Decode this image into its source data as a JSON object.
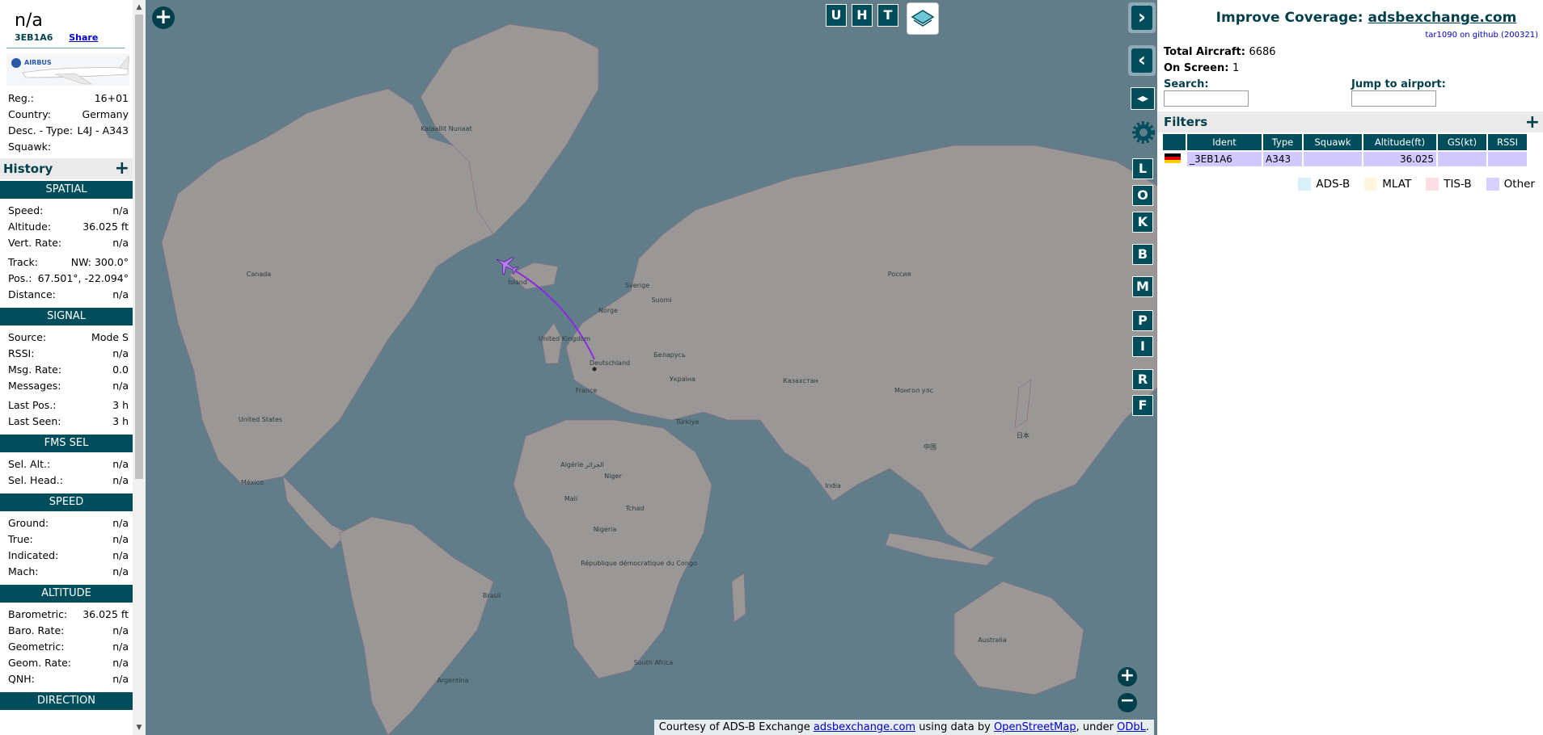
{
  "aircraft": {
    "callsign": "n/a",
    "hex": "3EB1A6",
    "share_label": "Share",
    "photo_alt": "AIRBUS",
    "reg_label": "Reg.:",
    "reg_value": "16+01",
    "country_label": "Country:",
    "country_value": "Germany",
    "desc_label": "Desc. - Type:",
    "desc_value": "L4J - A343",
    "squawk_label": "Squawk:",
    "squawk_value": ""
  },
  "history_label": "History",
  "sections": {
    "spatial": "SPATIAL",
    "signal": "SIGNAL",
    "fms": "FMS SEL",
    "speed": "SPEED",
    "altitude": "ALTITUDE",
    "direction": "DIRECTION"
  },
  "spatial": [
    {
      "label": "Speed:",
      "value": "n/a"
    },
    {
      "label": "Altitude:",
      "value": "36.025 ft"
    },
    {
      "label": "Vert. Rate:",
      "value": "n/a"
    },
    {
      "label": "Track:",
      "value": "NW: 300.0°"
    },
    {
      "label": "Pos.:",
      "value": "67.501°, -22.094°"
    },
    {
      "label": "Distance:",
      "value": "n/a"
    }
  ],
  "signal": [
    {
      "label": "Source:",
      "value": "Mode S"
    },
    {
      "label": "RSSI:",
      "value": "n/a"
    },
    {
      "label": "Msg. Rate:",
      "value": "0.0"
    },
    {
      "label": "Messages:",
      "value": "n/a"
    },
    {
      "label": "Last Pos.:",
      "value": "3 h"
    },
    {
      "label": "Last Seen:",
      "value": "3 h"
    }
  ],
  "fms": [
    {
      "label": "Sel. Alt.:",
      "value": "n/a"
    },
    {
      "label": "Sel. Head.:",
      "value": "n/a"
    }
  ],
  "speed": [
    {
      "label": "Ground:",
      "value": "n/a"
    },
    {
      "label": "True:",
      "value": "n/a"
    },
    {
      "label": "Indicated:",
      "value": "n/a"
    },
    {
      "label": "Mach:",
      "value": "n/a"
    }
  ],
  "altitude": [
    {
      "label": "Barometric:",
      "value": "36.025 ft"
    },
    {
      "label": "Baro. Rate:",
      "value": "n/a"
    },
    {
      "label": "Geometric:",
      "value": "n/a"
    },
    {
      "label": "Geom. Rate:",
      "value": "n/a"
    },
    {
      "label": "QNH:",
      "value": "n/a"
    }
  ],
  "map": {
    "top_buttons": [
      "U",
      "H",
      "T"
    ],
    "side_buttons": [
      "L",
      "O",
      "K",
      "B",
      "M",
      "P",
      "I",
      "R",
      "F"
    ],
    "labels": {
      "greenland": "Kalaallit Nunaat",
      "canada": "Canada",
      "us": "United States",
      "mexico": "México",
      "island": "Ísland",
      "sverige": "Sverige",
      "suomi": "Suomi",
      "norge": "Norge",
      "uk": "United Kingdom",
      "deutschland": "Deutschland",
      "france": "France",
      "belarus": "Беларусь",
      "ukraine": "Україна",
      "russia": "Россия",
      "kazakhstan": "Казахстан",
      "mongolia": "Монгол улс",
      "china": "中国",
      "japan": "日本",
      "india": "India",
      "turkiye": "Türkiye",
      "brasil": "Brasil",
      "argentina": "Argentina",
      "australia": "Australia",
      "south_africa": "South Africa",
      "niger": "Niger",
      "nigeria": "Nigeria",
      "mali": "Mali",
      "tchad": "Tchad",
      "congo": "République démocratique du Congo",
      "algeria": "Algérie الجزائر"
    },
    "attribution_prefix": "Courtesy of ADS-B Exchange ",
    "attribution_link1": "adsbexchange.com",
    "attribution_mid": " using data by ",
    "attribution_link2": "OpenStreetMap",
    "attribution_mid2": ", under ",
    "attribution_link3": "ODbL",
    "attribution_end": "."
  },
  "right": {
    "improve_prefix": "Improve Coverage: ",
    "improve_link": "adsbexchange.com",
    "github": "tar1090 on github (200321)",
    "total_label": "Total Aircraft:",
    "total_value": "6686",
    "onscreen_label": "On Screen:",
    "onscreen_value": "1",
    "search_label": "Search:",
    "jump_label": "Jump to airport:",
    "filters_label": "Filters",
    "columns": [
      "Ident",
      "Type",
      "Squawk",
      "Altitude(ft)",
      "GS(kt)",
      "RSSI"
    ],
    "row": {
      "ident": "_3EB1A6",
      "type": "A343",
      "squawk": "",
      "altitude": "36.025",
      "gs": "",
      "rssi": ""
    },
    "legend": [
      {
        "label": "ADS-B",
        "color": "#d8f0f8"
      },
      {
        "label": "MLAT",
        "color": "#fdf6dc"
      },
      {
        "label": "TIS-B",
        "color": "#fcdde4"
      },
      {
        "label": "Other",
        "color": "#d8d0ff"
      }
    ]
  }
}
